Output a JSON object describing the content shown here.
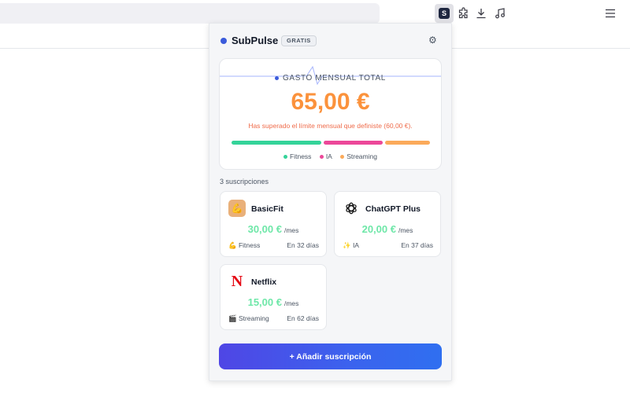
{
  "browser": {
    "extension_badge": "S"
  },
  "popup": {
    "brand": "SubPulse",
    "plan": "GRATIS",
    "summary": {
      "label": "GASTO MENSUAL TOTAL",
      "total": "65,00 €",
      "limit_message": "Has superado el límite mensual que definiste (60,00 €).",
      "breakdown": [
        {
          "category": "Fitness",
          "amount": 30,
          "color": "#34d399"
        },
        {
          "category": "IA",
          "amount": 20,
          "color": "#ec4899"
        },
        {
          "category": "Streaming",
          "amount": 15,
          "color": "#fbaa5a"
        }
      ]
    },
    "count_label": "3 suscripciones",
    "subscriptions": [
      {
        "name": "BasicFit",
        "price": "30,00 €",
        "period": "/mes",
        "category": "💪 Fitness",
        "renewal": "En 32 días",
        "logo": "💪",
        "logo_icon": "biceps-icon"
      },
      {
        "name": "ChatGPT Plus",
        "price": "20,00 €",
        "period": "/mes",
        "category": "✨ IA",
        "renewal": "En 37 días",
        "logo": "openai-icon"
      },
      {
        "name": "Netflix",
        "price": "15,00 €",
        "period": "/mes",
        "category": "🎬 Streaming",
        "renewal": "En 62 días",
        "logo": "N",
        "logo_icon": "netflix-icon"
      }
    ],
    "add_button": "+ Añadir suscripción"
  }
}
